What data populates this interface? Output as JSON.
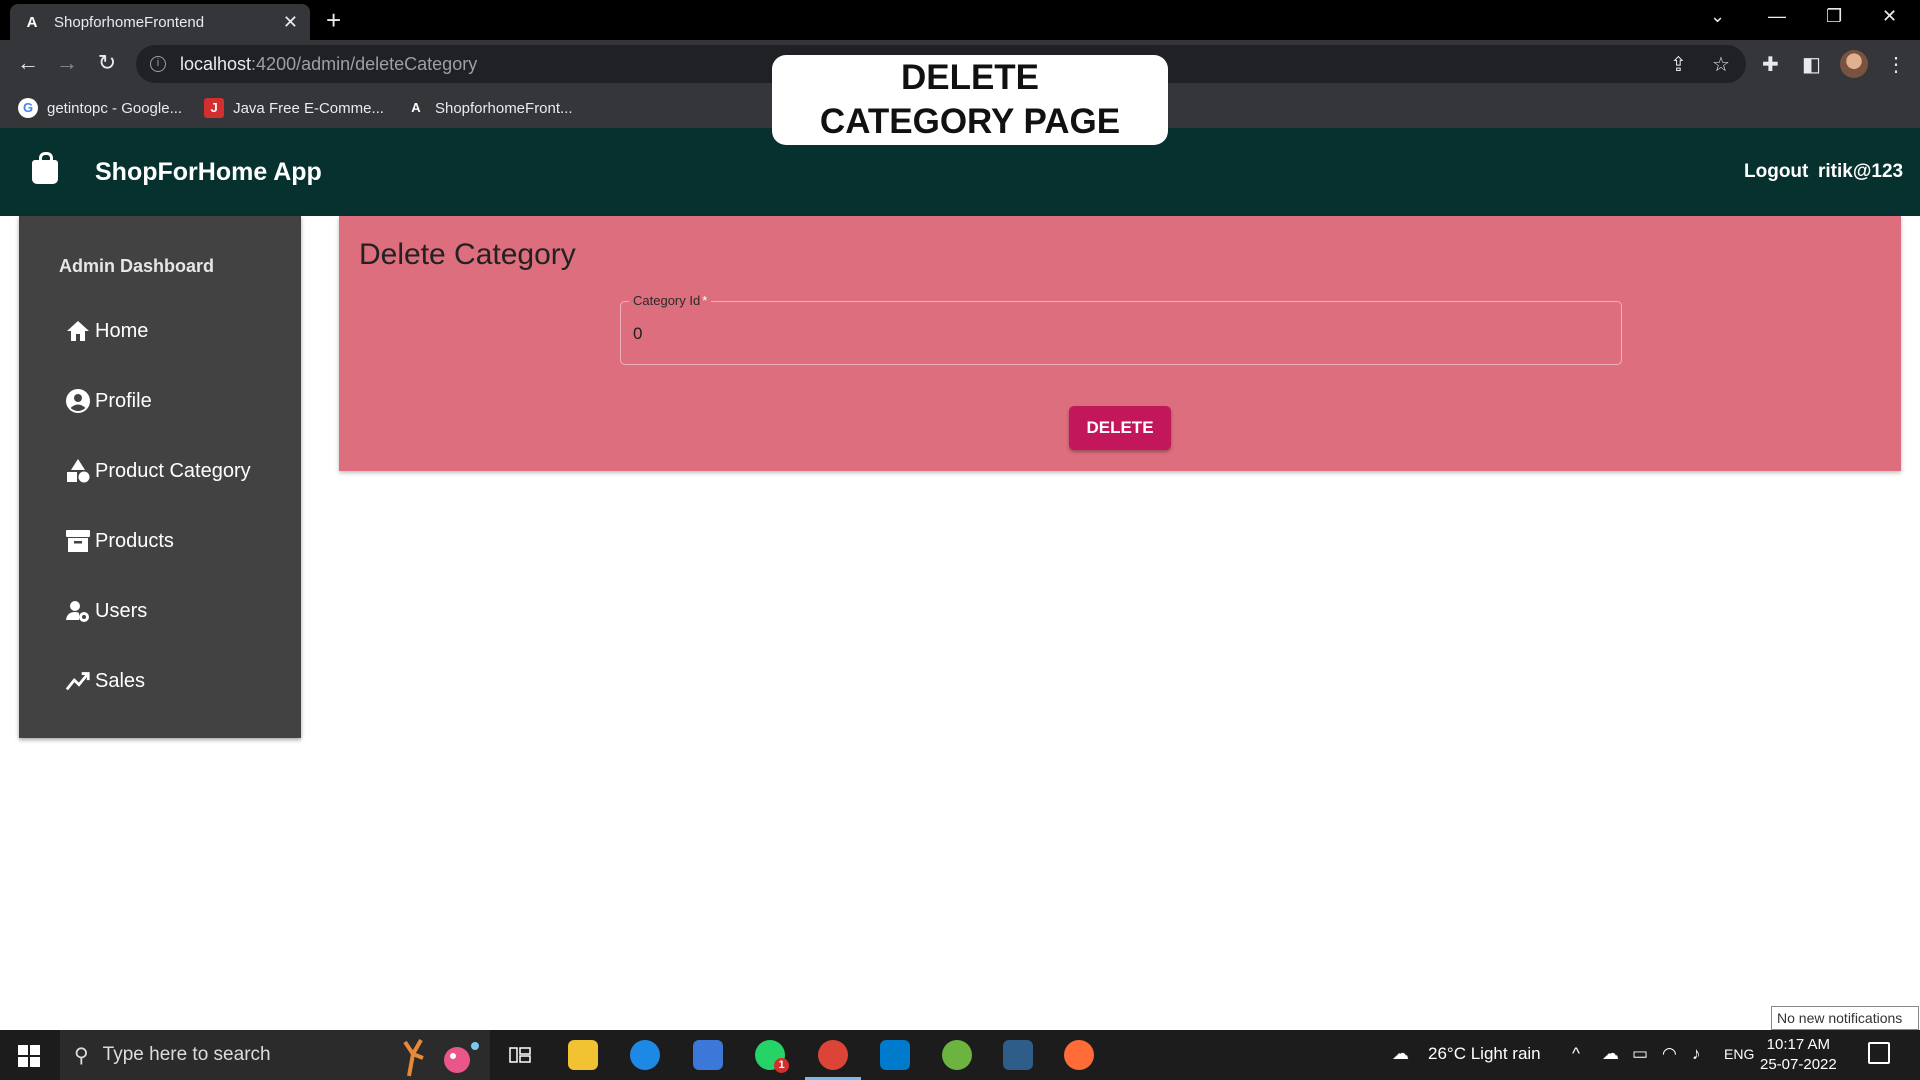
{
  "browser": {
    "tab_title": "ShopforhomeFrontend",
    "tab_favicon": "A",
    "new_tab_label": "+",
    "url_host": "localhost",
    "url_path": ":4200/admin/deleteCategory",
    "bookmarks": [
      {
        "label": "getintopc - Google...",
        "icon": "G",
        "color": "#ffffff"
      },
      {
        "label": "Java Free E-Comme...",
        "icon": "J",
        "color": "#d32f2f"
      },
      {
        "label": "ShopforhomeFront...",
        "icon": "A",
        "color": "#35363a"
      }
    ]
  },
  "overlay": {
    "line1": "DELETE",
    "line2": "CATEGORY PAGE"
  },
  "app": {
    "title": "ShopForHome App",
    "logout": "Logout",
    "user": "ritik@123",
    "header_color": "#06312f"
  },
  "sidebar": {
    "heading": "Admin Dashboard",
    "items": [
      {
        "label": "Home",
        "icon": "home-icon"
      },
      {
        "label": "Profile",
        "icon": "account-circle-icon"
      },
      {
        "label": "Product Category",
        "icon": "category-icon"
      },
      {
        "label": "Products",
        "icon": "inventory-icon"
      },
      {
        "label": "Users",
        "icon": "manage-accounts-icon"
      },
      {
        "label": "Sales",
        "icon": "trending-up-icon"
      }
    ]
  },
  "form": {
    "title": "Delete Category",
    "field_label": "Category Id",
    "required_mark": "*",
    "field_value": "0",
    "submit": "DELETE",
    "card_color": "#dc6e7e",
    "button_color": "#c2185b"
  },
  "taskbar": {
    "search_placeholder": "Type here to search",
    "weather": "26°C  Light rain",
    "language": "ENG",
    "time": "10:17 AM",
    "date": "25-07-2022",
    "notification_tip": "No new notifications",
    "whatsapp_badge": "1"
  }
}
